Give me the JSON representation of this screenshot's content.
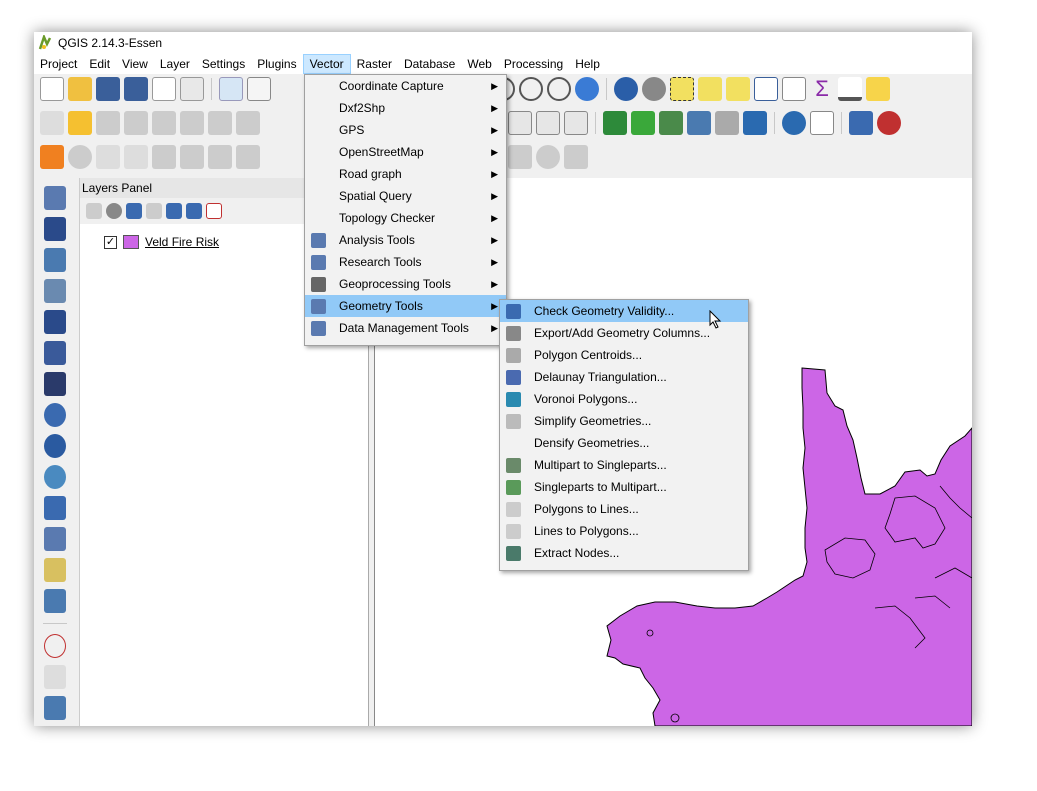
{
  "window": {
    "title": "QGIS 2.14.3-Essen"
  },
  "menubar": [
    "Project",
    "Edit",
    "View",
    "Layer",
    "Settings",
    "Plugins",
    "Vector",
    "Raster",
    "Database",
    "Web",
    "Processing",
    "Help"
  ],
  "active_menu": "Vector",
  "vector_menu": {
    "items": [
      {
        "label": "Coordinate Capture",
        "icon": "none",
        "submenu": true
      },
      {
        "label": "Dxf2Shp",
        "icon": "none",
        "submenu": true
      },
      {
        "label": "GPS",
        "icon": "none",
        "submenu": true
      },
      {
        "label": "OpenStreetMap",
        "icon": "none",
        "submenu": true
      },
      {
        "label": "Road graph",
        "icon": "none",
        "submenu": true
      },
      {
        "label": "Spatial Query",
        "icon": "none",
        "submenu": true
      },
      {
        "label": "Topology Checker",
        "icon": "none",
        "submenu": true
      },
      {
        "label": "Analysis Tools",
        "icon": "analysis-icon",
        "submenu": true
      },
      {
        "label": "Research Tools",
        "icon": "research-icon",
        "submenu": true
      },
      {
        "label": "Geoprocessing Tools",
        "icon": "geoprocessing-icon",
        "submenu": true
      },
      {
        "label": "Geometry Tools",
        "icon": "geometry-icon",
        "submenu": true,
        "highlighted": true
      },
      {
        "label": "Data Management Tools",
        "icon": "data-management-icon",
        "submenu": true
      }
    ]
  },
  "geometry_submenu": {
    "items": [
      {
        "label": "Check Geometry Validity...",
        "icon": "check-geometry-icon",
        "highlighted": true
      },
      {
        "label": "Export/Add Geometry Columns...",
        "icon": "export-geometry-icon"
      },
      {
        "label": "Polygon Centroids...",
        "icon": "centroids-icon"
      },
      {
        "label": "Delaunay Triangulation...",
        "icon": "delaunay-icon"
      },
      {
        "label": "Voronoi Polygons...",
        "icon": "voronoi-icon"
      },
      {
        "label": "Simplify Geometries...",
        "icon": "simplify-icon"
      },
      {
        "label": "Densify Geometries...",
        "icon": "none"
      },
      {
        "label": "Multipart to Singleparts...",
        "icon": "multipart-icon"
      },
      {
        "label": "Singleparts to Multipart...",
        "icon": "singleparts-icon"
      },
      {
        "label": "Polygons to Lines...",
        "icon": "polygons-to-lines-icon"
      },
      {
        "label": "Lines to Polygons...",
        "icon": "lines-to-polygons-icon"
      },
      {
        "label": "Extract Nodes...",
        "icon": "extract-nodes-icon"
      }
    ]
  },
  "layers_panel": {
    "title": "Layers Panel",
    "layers": [
      {
        "name": "Veld Fire Risk",
        "checked": true,
        "color": "#cc66e6"
      }
    ]
  },
  "colors": {
    "accent_highlight": "#91c9f7",
    "layer_fill": "#cc66e6",
    "menu_active": "#cce8ff"
  }
}
